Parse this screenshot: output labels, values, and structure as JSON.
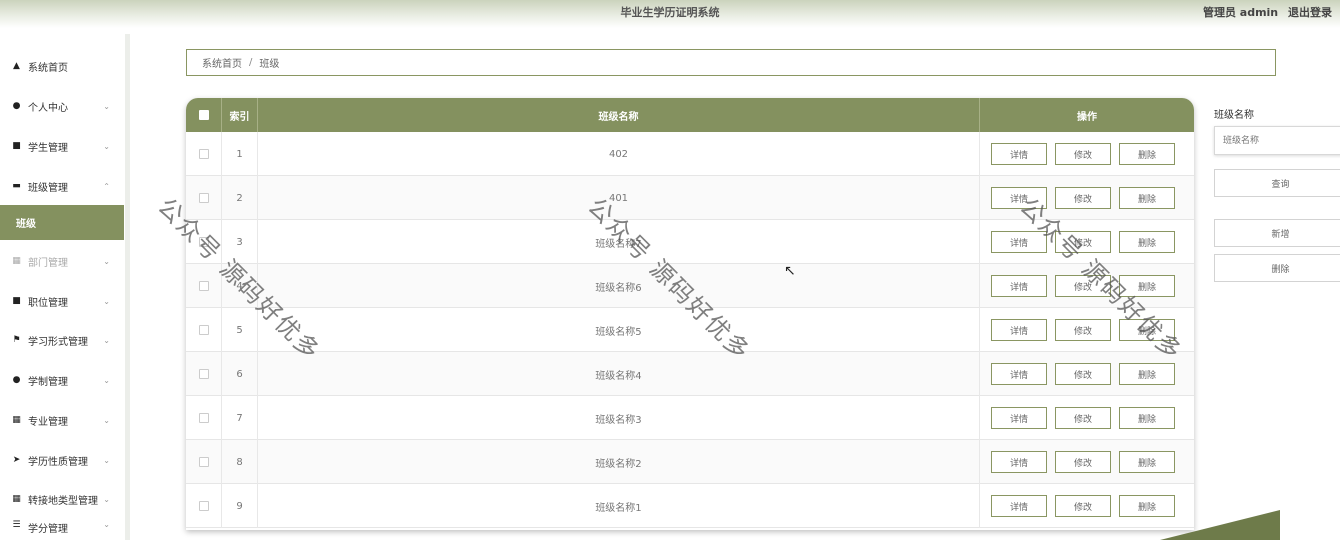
{
  "header": {
    "system_title": "毕业生学历证明系统",
    "user_label": "管理员 admin",
    "logout_label": "退出登录"
  },
  "sidebar": {
    "items": [
      {
        "label": "系统首页",
        "icon": "home-icon"
      },
      {
        "label": "个人中心",
        "icon": "user-icon"
      },
      {
        "label": "学生管理",
        "icon": "monitor-icon"
      },
      {
        "label": "班级管理",
        "icon": "chat-icon"
      },
      {
        "label": "班级",
        "icon": ""
      },
      {
        "label": "部门管理",
        "icon": "grid-icon"
      },
      {
        "label": "职位管理",
        "icon": "monitor-icon"
      },
      {
        "label": "学习形式管理",
        "icon": "flag-icon"
      },
      {
        "label": "学制管理",
        "icon": "user-icon"
      },
      {
        "label": "专业管理",
        "icon": "grid-icon"
      },
      {
        "label": "学历性质管理",
        "icon": "send-icon"
      },
      {
        "label": "转接地类型管理",
        "icon": "grid-icon"
      },
      {
        "label": "学分管理",
        "icon": "list-icon"
      }
    ]
  },
  "breadcrumb": {
    "home": "系统首页",
    "separator": "/",
    "current": "班级"
  },
  "table": {
    "columns": {
      "index": "索引",
      "name": "班级名称",
      "ops": "操作"
    },
    "row_actions": {
      "detail": "详情",
      "edit": "修改",
      "delete": "删除"
    },
    "rows": [
      {
        "index": "1",
        "name": "402"
      },
      {
        "index": "2",
        "name": "401"
      },
      {
        "index": "3",
        "name": "班级名称7"
      },
      {
        "index": "4",
        "name": "班级名称6"
      },
      {
        "index": "5",
        "name": "班级名称5"
      },
      {
        "index": "6",
        "name": "班级名称4"
      },
      {
        "index": "7",
        "name": "班级名称3"
      },
      {
        "index": "8",
        "name": "班级名称2"
      },
      {
        "index": "9",
        "name": "班级名称1"
      }
    ]
  },
  "search_panel": {
    "label": "班级名称",
    "placeholder": "班级名称",
    "query_button": "查询",
    "add_button": "新增",
    "delete_button": "删除"
  },
  "watermark": {
    "text": "公众号 源码好优多"
  },
  "colors": {
    "accent": "#84915f",
    "accent_dark": "#6e7b4a"
  }
}
